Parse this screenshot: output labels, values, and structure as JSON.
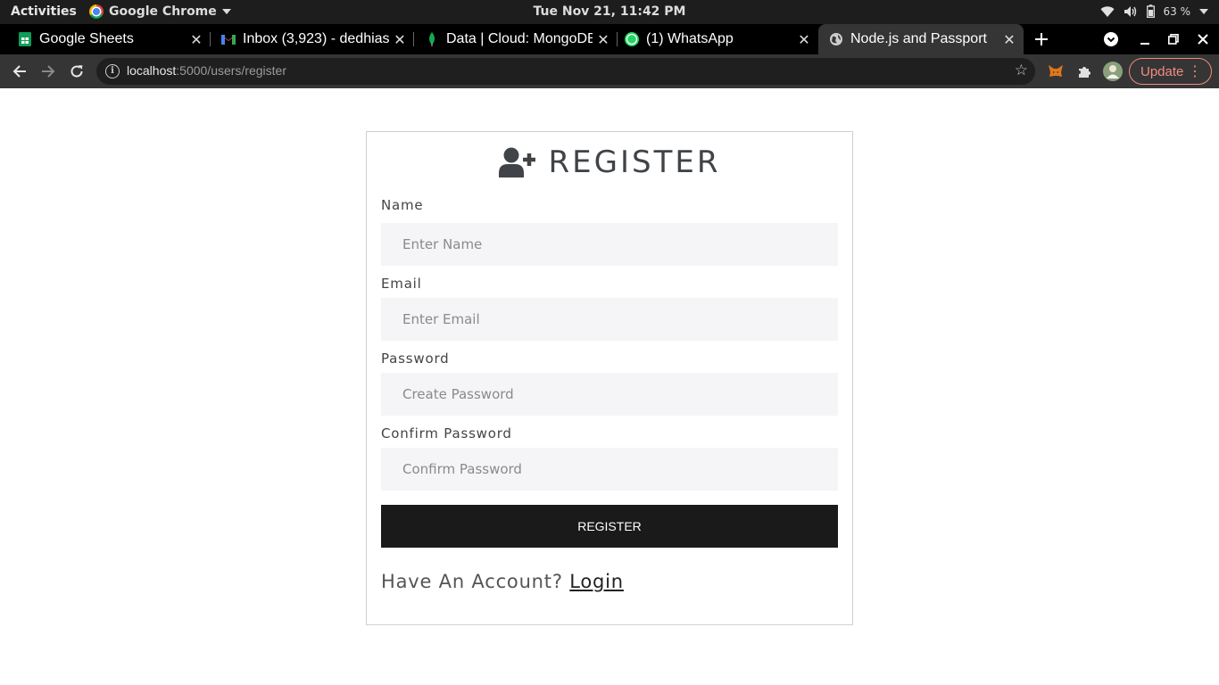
{
  "os_bar": {
    "activities": "Activities",
    "app_name": "Google Chrome",
    "clock": "Tue Nov 21, 11:42 PM",
    "battery": "63 %"
  },
  "tabs": [
    {
      "title": "Google Sheets",
      "icon": "google-sheets-icon",
      "color": "#0f9d58"
    },
    {
      "title": "Inbox (3,923) - dedhias",
      "icon": "gmail-icon",
      "color": "#ea4335"
    },
    {
      "title": "Data | Cloud: MongoDB",
      "icon": "mongodb-leaf-icon",
      "color": "#13aa52"
    },
    {
      "title": "(1) WhatsApp",
      "icon": "whatsapp-icon",
      "color": "#25d366"
    },
    {
      "title": "Node.js and Passport",
      "icon": "globe-icon",
      "active": true
    }
  ],
  "omnibox": {
    "host": "localhost",
    "path": ":5000/users/register"
  },
  "toolbar": {
    "update_label": "Update"
  },
  "form": {
    "title": "REGISTER",
    "title_icon": "user-plus-icon",
    "name_label": "Name",
    "name_placeholder": "Enter Name",
    "email_label": "Email",
    "email_placeholder": "Enter Email",
    "password_label": "Password",
    "password_placeholder": "Create Password",
    "confirm_label": "Confirm Password",
    "confirm_placeholder": "Confirm Password",
    "submit_label": "REGISTER",
    "footer_text": "Have An Account?",
    "login_link": "Login"
  }
}
